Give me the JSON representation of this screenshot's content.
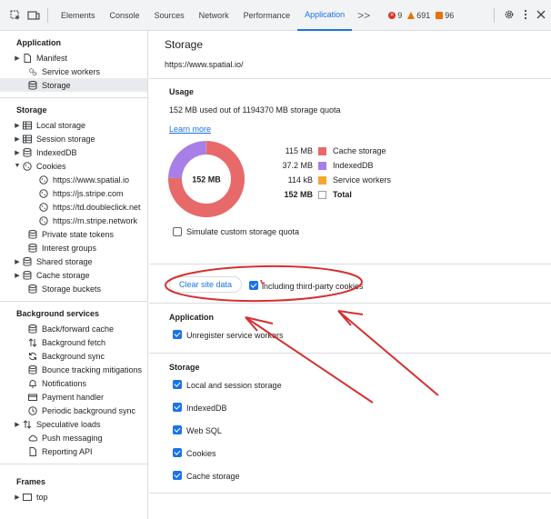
{
  "toolbar": {
    "tabs": [
      "Elements",
      "Console",
      "Sources",
      "Network",
      "Performance",
      "Application"
    ],
    "active_tab": "Application",
    "more_tabs": ">>",
    "errors": "9",
    "warnings": "691",
    "issues": "96"
  },
  "sidebar": {
    "application": {
      "heading": "Application",
      "items": [
        "Manifest",
        "Service workers",
        "Storage"
      ]
    },
    "storage": {
      "heading": "Storage",
      "items": [
        "Local storage",
        "Session storage",
        "IndexedDB",
        "Cookies"
      ],
      "cookies": [
        "https://www.spatial.io",
        "https://js.stripe.com",
        "https://td.doubleclick.net",
        "https://m.stripe.network"
      ],
      "more": [
        "Private state tokens",
        "Interest groups",
        "Shared storage",
        "Cache storage",
        "Storage buckets"
      ]
    },
    "background": {
      "heading": "Background services",
      "items": [
        "Back/forward cache",
        "Background fetch",
        "Background sync",
        "Bounce tracking mitigations",
        "Notifications",
        "Payment handler",
        "Periodic background sync",
        "Speculative loads",
        "Push messaging",
        "Reporting API"
      ]
    },
    "frames": {
      "heading": "Frames",
      "items": [
        "top"
      ]
    }
  },
  "main": {
    "title": "Storage",
    "origin": "https://www.spatial.io/",
    "usage": {
      "heading": "Usage",
      "summary": "152 MB used out of 1194370 MB storage quota",
      "learn_more": "Learn more",
      "donut_label": "152 MB",
      "legend": [
        {
          "value": "115 MB",
          "label": "Cache storage",
          "color": "#e8696a"
        },
        {
          "value": "37.2 MB",
          "label": "IndexedDB",
          "color": "#a87ee8"
        },
        {
          "value": "114 kB",
          "label": "Service workers",
          "color": "#f0a830"
        },
        {
          "value": "152 MB",
          "label": "Total",
          "color": "#ffffff"
        }
      ],
      "simulate_label": "Simulate custom storage quota",
      "simulate_checked": false
    },
    "clear": {
      "button": "Clear site data",
      "third_party_label": "including third-party cookies",
      "third_party_checked": true
    },
    "application": {
      "heading": "Application",
      "options": [
        {
          "label": "Unregister service workers",
          "checked": true
        }
      ]
    },
    "storage": {
      "heading": "Storage",
      "options": [
        {
          "label": "Local and session storage",
          "checked": true
        },
        {
          "label": "IndexedDB",
          "checked": true
        },
        {
          "label": "Web SQL",
          "checked": true
        },
        {
          "label": "Cookies",
          "checked": true
        },
        {
          "label": "Cache storage",
          "checked": true
        }
      ]
    },
    "chart_data": {
      "type": "pie",
      "categories": [
        "Cache storage",
        "IndexedDB",
        "Service workers"
      ],
      "values": [
        115,
        37.2,
        0.114
      ],
      "unit": "MB",
      "center_label": "152 MB"
    }
  },
  "colors": {
    "accent": "#1a73e8",
    "annotation": "#d63030"
  }
}
